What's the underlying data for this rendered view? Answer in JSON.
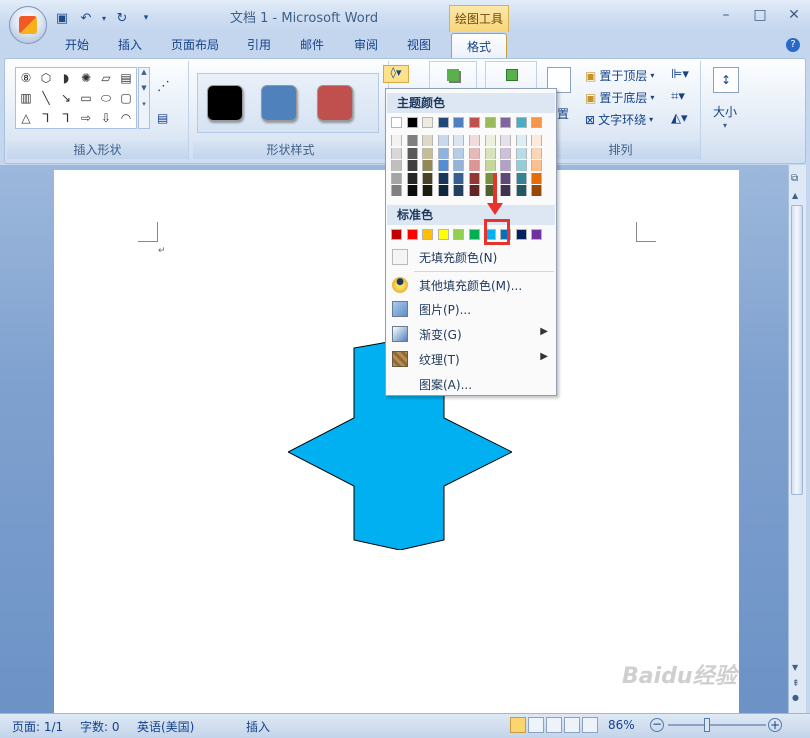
{
  "window": {
    "title": "文档 1 - Microsoft Word",
    "contextual_tab_group": "绘图工具",
    "controls": [
      "minimize-icon",
      "restore-icon",
      "close-icon"
    ]
  },
  "quick_access": [
    "save-icon",
    "undo-icon",
    "redo-icon",
    "customize-icon"
  ],
  "tabs": [
    "开始",
    "插入",
    "页面布局",
    "引用",
    "邮件",
    "审阅",
    "视图",
    "格式"
  ],
  "active_tab": "格式",
  "ribbon": {
    "groups": {
      "insert_shapes": "插入形状",
      "shape_styles": "形状样式",
      "arrange": "排列",
      "size": "大小"
    },
    "arrange_buttons": {
      "bring_front": "置于顶层",
      "send_back": "置于底层",
      "text_wrap": "文字环绕",
      "position_partial": "置"
    },
    "style_colors": [
      "#000000",
      "#4f81bd",
      "#c0504d"
    ]
  },
  "fill_menu": {
    "theme_header": "主题颜色",
    "standard_header": "标准色",
    "theme_top_row": [
      "#ffffff",
      "#000000",
      "#eeece1",
      "#1f497d",
      "#4f81bd",
      "#c0504d",
      "#9bbb59",
      "#8064a2",
      "#4bacc6",
      "#f79646"
    ],
    "theme_columns": [
      [
        "#f2f2f2",
        "#d8d8d8",
        "#bfbfbf",
        "#a5a5a5",
        "#7f7f7f"
      ],
      [
        "#7f7f7f",
        "#595959",
        "#3f3f3f",
        "#262626",
        "#0c0c0c"
      ],
      [
        "#ddd9c3",
        "#c4bd97",
        "#938953",
        "#494429",
        "#1d1b10"
      ],
      [
        "#c6d9f0",
        "#8db3e2",
        "#548dd4",
        "#17365d",
        "#0f243e"
      ],
      [
        "#dbe5f1",
        "#b8cce4",
        "#95b3d7",
        "#366092",
        "#244061"
      ],
      [
        "#f2dcdb",
        "#e5b9b7",
        "#d99694",
        "#953734",
        "#632423"
      ],
      [
        "#ebf1dd",
        "#d7e3bc",
        "#c3d69b",
        "#76923c",
        "#4f6128"
      ],
      [
        "#e5e0ec",
        "#ccc1d9",
        "#b2a2c7",
        "#5f497a",
        "#3f3151"
      ],
      [
        "#dbeef3",
        "#b7dde8",
        "#92cddc",
        "#31859b",
        "#205867"
      ],
      [
        "#fdeada",
        "#fbd5b5",
        "#fac08f",
        "#e36c09",
        "#974806"
      ]
    ],
    "standard_colors": [
      "#c00000",
      "#ff0000",
      "#ffc000",
      "#ffff00",
      "#92d050",
      "#00b050",
      "#00b0f0",
      "#0070c0",
      "#002060",
      "#7030a0"
    ],
    "highlighted_color": "#00b0f0",
    "items": {
      "no_fill": "无填充颜色(N)",
      "more_colors": "其他填充颜色(M)...",
      "picture": "图片(P)...",
      "gradient": "渐变(G)",
      "texture": "纹理(T)",
      "pattern": "图案(A)..."
    }
  },
  "document": {
    "shape_fill": "#00b0f0",
    "shape_type": "8-point-star"
  },
  "status": {
    "page": "页面: 1/1",
    "words": "字数: 0",
    "language": "英语(美国)",
    "mode": "插入",
    "zoom": "86%"
  },
  "watermark": "Baidu经验"
}
